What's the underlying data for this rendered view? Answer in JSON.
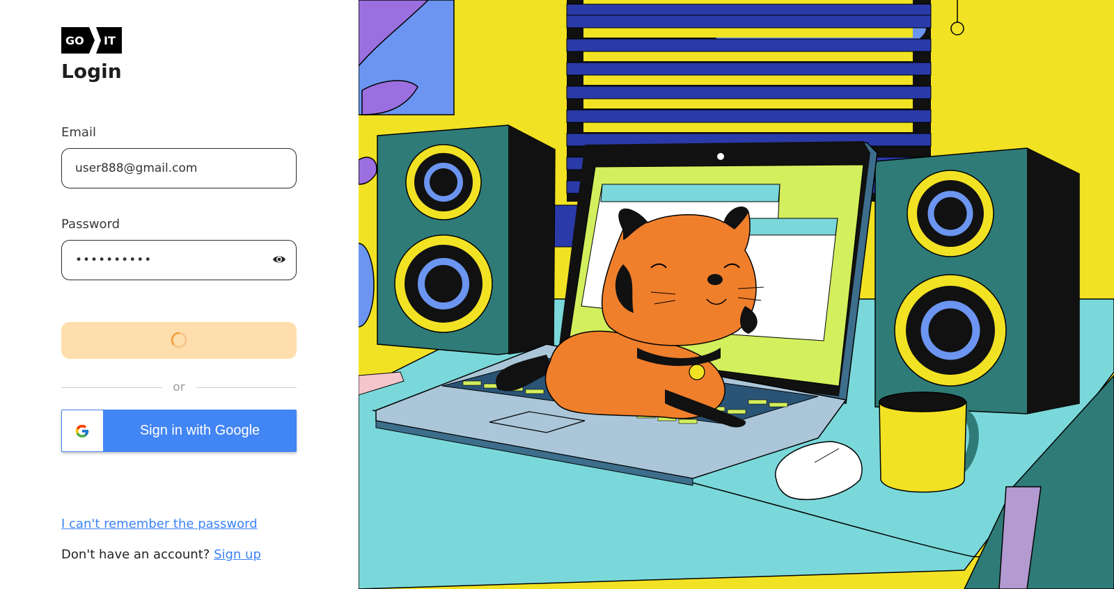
{
  "brand": {
    "logo_left": "GO",
    "logo_right": "IT"
  },
  "page": {
    "title": "Login"
  },
  "form": {
    "email_label": "Email",
    "email_value": "user888@gmail.com",
    "password_label": "Password",
    "password_value": "••••••••••",
    "submit_state": "loading",
    "divider_text": "or",
    "google_label": "Sign in with Google"
  },
  "footer": {
    "forgot_link": "I can't remember the password",
    "no_account_text": "Don't have an account?",
    "signup_link": "Sign up"
  },
  "icons": [
    "go-it-logo",
    "eye-icon",
    "spinner-icon",
    "google-icon"
  ],
  "colors": {
    "accent_button": "#ffdead",
    "spinner": "#f29b38",
    "google_blue": "#4285f4",
    "link": "#3b82f6",
    "illustration_background": "#f2e224",
    "desk": "#7ad8da",
    "speaker": "#2f7b77",
    "cat": "#f07f2c"
  }
}
